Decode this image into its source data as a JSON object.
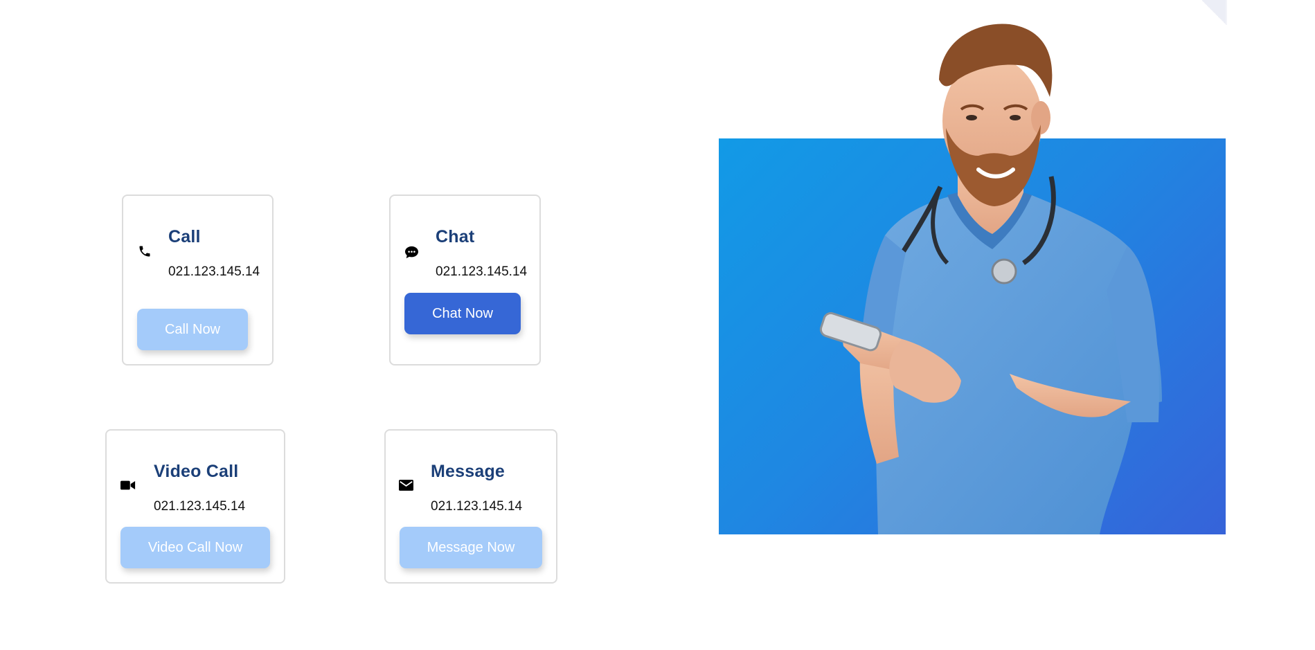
{
  "cards": {
    "call": {
      "title": "Call",
      "phone": "021.123.145.14",
      "button": "Call Now",
      "icon": "phone-icon"
    },
    "chat": {
      "title": "Chat",
      "phone": "021.123.145.14",
      "button": "Chat Now",
      "icon": "chat-bubble-icon"
    },
    "video": {
      "title": "Video Call",
      "phone": "021.123.145.14",
      "button": "Video Call Now",
      "icon": "video-camera-icon"
    },
    "message": {
      "title": "Message",
      "phone": "021.123.145.14",
      "button": "Message Now",
      "icon": "envelope-icon"
    }
  },
  "colors": {
    "title": "#1b3f78",
    "button_light": "#a4cbfa",
    "button_dark": "#3667d6",
    "hero_gradient_start": "#129ae6",
    "hero_gradient_end": "#3663d9",
    "card_border": "#dcdcdc"
  },
  "hero": {
    "image": "doctor-with-phone-photo"
  }
}
